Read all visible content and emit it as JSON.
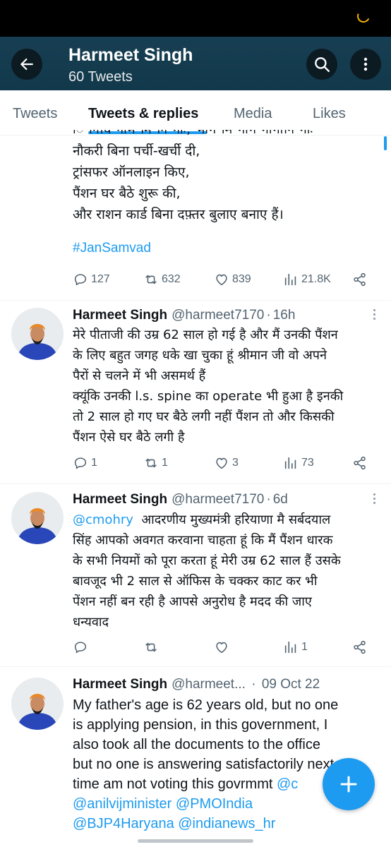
{
  "header": {
    "name": "Harmeet Singh",
    "tweet_count": "60 Tweets"
  },
  "tabs": [
    "Tweets",
    "Tweets & replies",
    "Media",
    "Likes"
  ],
  "first_tweet": {
    "partial_top": "ि निधि नाम मि नि गाः, भाग मि गीग गीगानि गाः",
    "lines": [
      "नौकरी बिना पर्ची-खर्ची दी,",
      "ट्रांसफर ऑनलाइन किए,",
      "पैंशन घर बैठे शुरू की,",
      "और राशन कार्ड बिना दफ़्तर बुलाए बनाए हैं।"
    ],
    "hashtag": "#JanSamvad",
    "stats": {
      "replies": "127",
      "retweets": "632",
      "likes": "839",
      "views": "21.8K"
    }
  },
  "tweets": [
    {
      "name": "Harmeet Singh",
      "handle": "@harmeet7170",
      "time": "16h",
      "lines": [
        "मेरे पीताजी की उम्र 62 साल हो गई है और मैं उनकी पैंशन",
        "के लिए बहुत जगह धके खा चुका हूं श्रीमान जी वो अपने",
        "पैरों से चलने में भी असमर्थ हैं",
        "क्यूंकि उनकी l.s. spine का operate भी हुआ है इनकी",
        "तो 2 साल हो गए घर बैठे लगी नहीं पैंशन तो और किसकी",
        "पैंशन ऐसे घर बैठे लगी है"
      ],
      "stats": {
        "replies": "1",
        "retweets": "1",
        "likes": "3",
        "views": "73"
      }
    },
    {
      "name": "Harmeet Singh",
      "handle": "@harmeet7170",
      "time": "6d",
      "mention": "@cmohry",
      "first_line_rest": "  आदरणीय मुख्यमंत्री हरियाणा मै सर्बदयाल",
      "lines": [
        "सिंह आपको अवगत करवाना चाहता हूं कि मैं पैंशन धारक",
        "के सभी नियमों को पूरा करता हूं मेरी उम्र 62 साल हैं उसके",
        "बावजूद भी 2 साल से ऑफिस के चक्कर काट कर भी",
        "पेंशन नहीं बन रही है आपसे अनुरोध है मदद की जाए",
        "धन्यवाद"
      ],
      "stats": {
        "replies": "",
        "retweets": "",
        "likes": "",
        "views": "1"
      }
    },
    {
      "name": "Harmeet Singh",
      "handle": "@harmeet...",
      "time": "09 Oct 22",
      "lines": [
        "My father's age is 62 years old, but no one",
        "is applying pension, in this government, I",
        "also took all the documents to the office",
        "but no one is answering satisfactorily next",
        "time am not voting this govrmmt"
      ],
      "mention_tail": "@c",
      "mentions_line1": "@anilvijminister @PMOIndia",
      "mentions_line2": "@BJP4Haryana @indianews_hr"
    }
  ],
  "colors": {
    "accent": "#1d9bf0",
    "header_bg": "#11394b",
    "text": "#0f1419",
    "muted": "#536471"
  },
  "icons": [
    "back-arrow-icon",
    "search-icon",
    "more-vertical-icon",
    "reply-icon",
    "retweet-icon",
    "like-icon",
    "views-icon",
    "share-icon",
    "plus-icon"
  ]
}
